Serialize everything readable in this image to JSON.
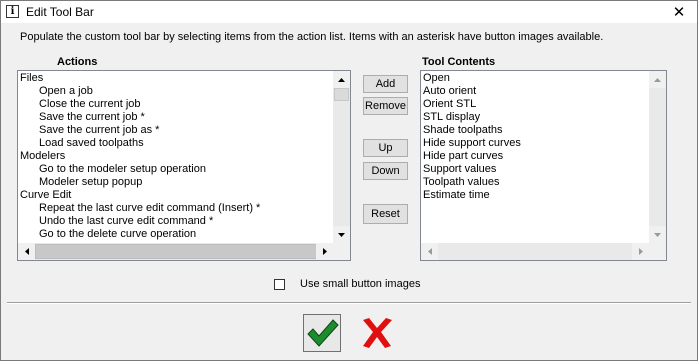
{
  "window": {
    "title": "Edit Tool Bar",
    "close_symbol": "✕"
  },
  "description": "Populate the custom tool bar by selecting items from the action list. Items with an asterisk have button images available.",
  "actions": {
    "header": "Actions",
    "items": [
      {
        "label": "Files",
        "indent": false
      },
      {
        "label": "Open a job",
        "indent": true
      },
      {
        "label": "Close the current job",
        "indent": true
      },
      {
        "label": "Save the current job *",
        "indent": true
      },
      {
        "label": "Save the current job as *",
        "indent": true
      },
      {
        "label": "Load saved toolpaths",
        "indent": true
      },
      {
        "label": "Modelers",
        "indent": false
      },
      {
        "label": "Go to the modeler setup operation",
        "indent": true
      },
      {
        "label": "Modeler setup popup",
        "indent": true
      },
      {
        "label": "Curve Edit",
        "indent": false
      },
      {
        "label": "Repeat the last curve edit command (Insert) *",
        "indent": true
      },
      {
        "label": "Undo the last curve edit command *",
        "indent": true
      },
      {
        "label": "Go to the delete curve operation",
        "indent": true
      }
    ]
  },
  "tool_contents": {
    "header": "Tool Contents",
    "items": [
      "Open",
      "Auto orient",
      "Orient STL",
      "STL display",
      "Shade toolpaths",
      "Hide support curves",
      "Hide part curves",
      "Support values",
      "Toolpath values",
      "Estimate time"
    ]
  },
  "buttons": {
    "add": "Add",
    "remove": "Remove",
    "up": "Up",
    "down": "Down",
    "reset": "Reset"
  },
  "small_images": {
    "label": "Use small button images",
    "checked": false
  },
  "colors": {
    "ok_green": "#1e8c2e",
    "cancel_red": "#e01010"
  }
}
